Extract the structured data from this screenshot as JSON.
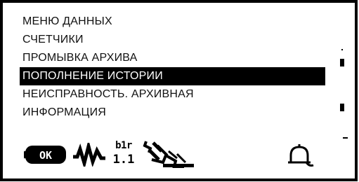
{
  "menu": {
    "title": "МЕНЮ ДАННЫХ",
    "items": [
      {
        "label": "СЧЕТЧИКИ"
      },
      {
        "label": "ПРОМЫВКА АРХИВА"
      },
      {
        "label": "ПОПОЛНЕНИЕ ИСТОРИИ",
        "selected": true
      },
      {
        "label": "НЕИСПРАВНОСТЬ. АРХИВНАЯ"
      },
      {
        "label": "ИНФОРМАЦИЯ"
      }
    ]
  },
  "status_icons": {
    "ok_label": "OK",
    "version_top": "b1r",
    "version_bottom": "1.1",
    "icons": [
      "ok-icon",
      "waveform-icon",
      "version-icon",
      "valve-icon",
      "bell-icon"
    ]
  },
  "colors": {
    "foreground": "#000000",
    "background": "#ffffff"
  }
}
